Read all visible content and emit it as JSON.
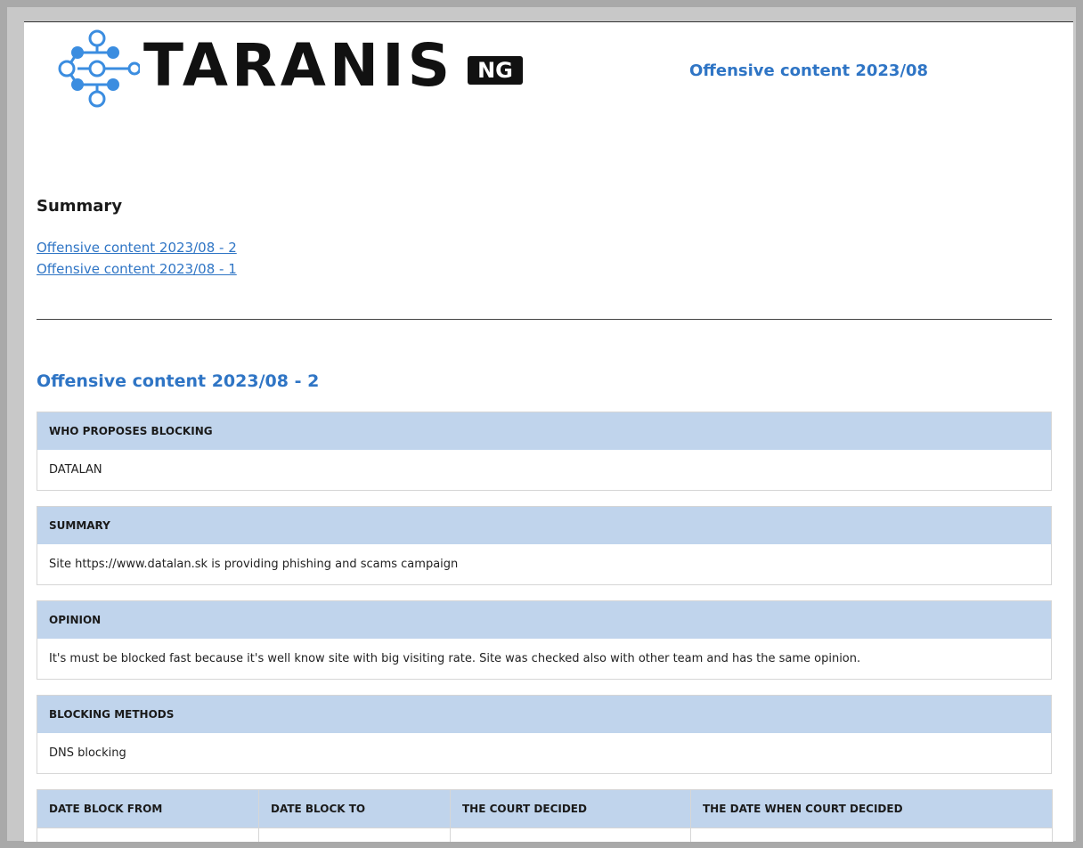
{
  "header": {
    "logo_text": "TARANIS",
    "logo_badge": "NG",
    "title": "Offensive content 2023/08"
  },
  "summary": {
    "heading": "Summary",
    "links": [
      "Offensive content 2023/08 - 2",
      "Offensive content 2023/08 - 1"
    ]
  },
  "report": {
    "title": "Offensive content 2023/08 - 2",
    "fields": [
      {
        "label": "WHO PROPOSES BLOCKING",
        "value": "DATALAN"
      },
      {
        "label": "SUMMARY",
        "value": "Site https://www.datalan.sk is providing phishing and scams campaign"
      },
      {
        "label": "OPINION",
        "value": "It's must be blocked fast because it's well know site with big visiting rate. Site was checked also with other team and has the same opinion."
      },
      {
        "label": "BLOCKING METHODS",
        "value": "DNS blocking"
      }
    ],
    "dates_table": {
      "headers": [
        "DATE BLOCK FROM",
        "DATE BLOCK TO",
        "THE COURT DECIDED",
        "THE DATE WHEN COURT DECIDED"
      ]
    }
  },
  "colors": {
    "accent": "#2f75c5",
    "header_fill": "#c0d4ec",
    "logo_blue": "#3b8de0"
  }
}
